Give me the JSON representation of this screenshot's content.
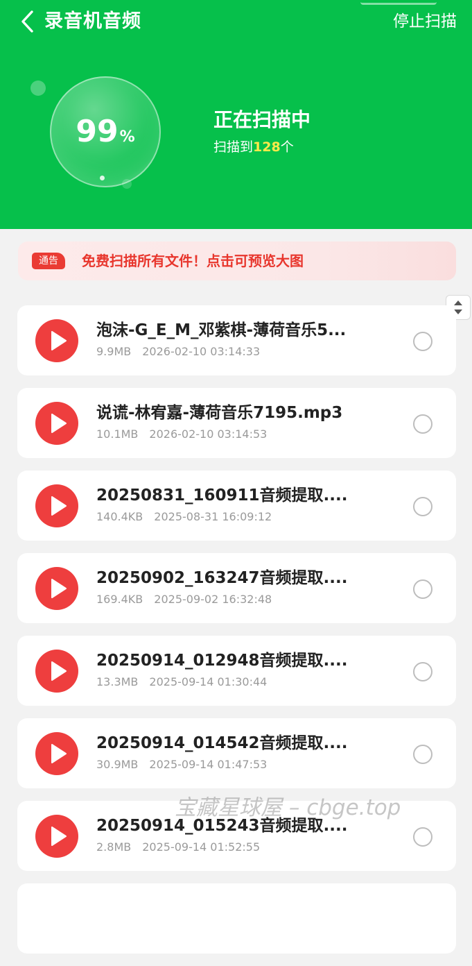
{
  "header": {
    "title": "录音机音频",
    "stop_label": "停止扫描",
    "progress_percent": "99",
    "percent_symbol": "%",
    "scan_status": "正在扫描中",
    "scan_count_prefix": "扫描到",
    "scan_count": "128",
    "scan_count_suffix": "个",
    "accent_color": "#06c04b"
  },
  "notice": {
    "badge": "通告",
    "text": "免费扫描所有文件！点击可预览大图"
  },
  "files": [
    {
      "name": "泡沫-G_E_M_邓紫棋-薄荷音乐5...",
      "size": "9.9MB",
      "date": "2026-02-10 03:14:33"
    },
    {
      "name": "说谎-林宥嘉-薄荷音乐7195.mp3",
      "size": "10.1MB",
      "date": "2026-02-10 03:14:53"
    },
    {
      "name": "20250831_160911音频提取....",
      "size": "140.4KB",
      "date": "2025-08-31 16:09:12"
    },
    {
      "name": "20250902_163247音频提取....",
      "size": "169.4KB",
      "date": "2025-09-02 16:32:48"
    },
    {
      "name": "20250914_012948音频提取....",
      "size": "13.3MB",
      "date": "2025-09-14 01:30:44"
    },
    {
      "name": "20250914_014542音频提取....",
      "size": "30.9MB",
      "date": "2025-09-14 01:47:53"
    },
    {
      "name": "20250914_015243音频提取....",
      "size": "2.8MB",
      "date": "2025-09-14 01:52:55"
    }
  ],
  "watermark": "宝藏星球屋 – cbge.top"
}
